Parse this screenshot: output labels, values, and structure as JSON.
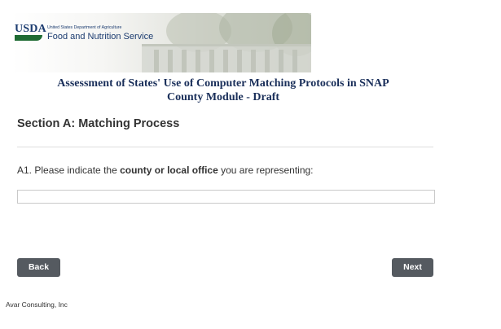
{
  "header": {
    "logo": {
      "mark": "USDA",
      "department": "United States Department of Agriculture",
      "agency": "Food and Nutrition Service"
    },
    "title_line1": "Assessment of States' Use of Computer Matching Protocols in SNAP",
    "title_line2": "County Module - Draft"
  },
  "section": {
    "heading": "Section A: Matching Process"
  },
  "question": {
    "prefix": "A1. Please indicate the ",
    "emphasis": "county or local office",
    "suffix": " you are representing:",
    "answer_value": ""
  },
  "navigation": {
    "back_label": "Back",
    "next_label": "Next"
  },
  "footer": {
    "credit": "Avar Consulting, Inc"
  },
  "colors": {
    "title": "#1a2f5a",
    "button_bg": "#555a60",
    "usda_blue": "#1b3b6f",
    "usda_green": "#1f6b33"
  }
}
